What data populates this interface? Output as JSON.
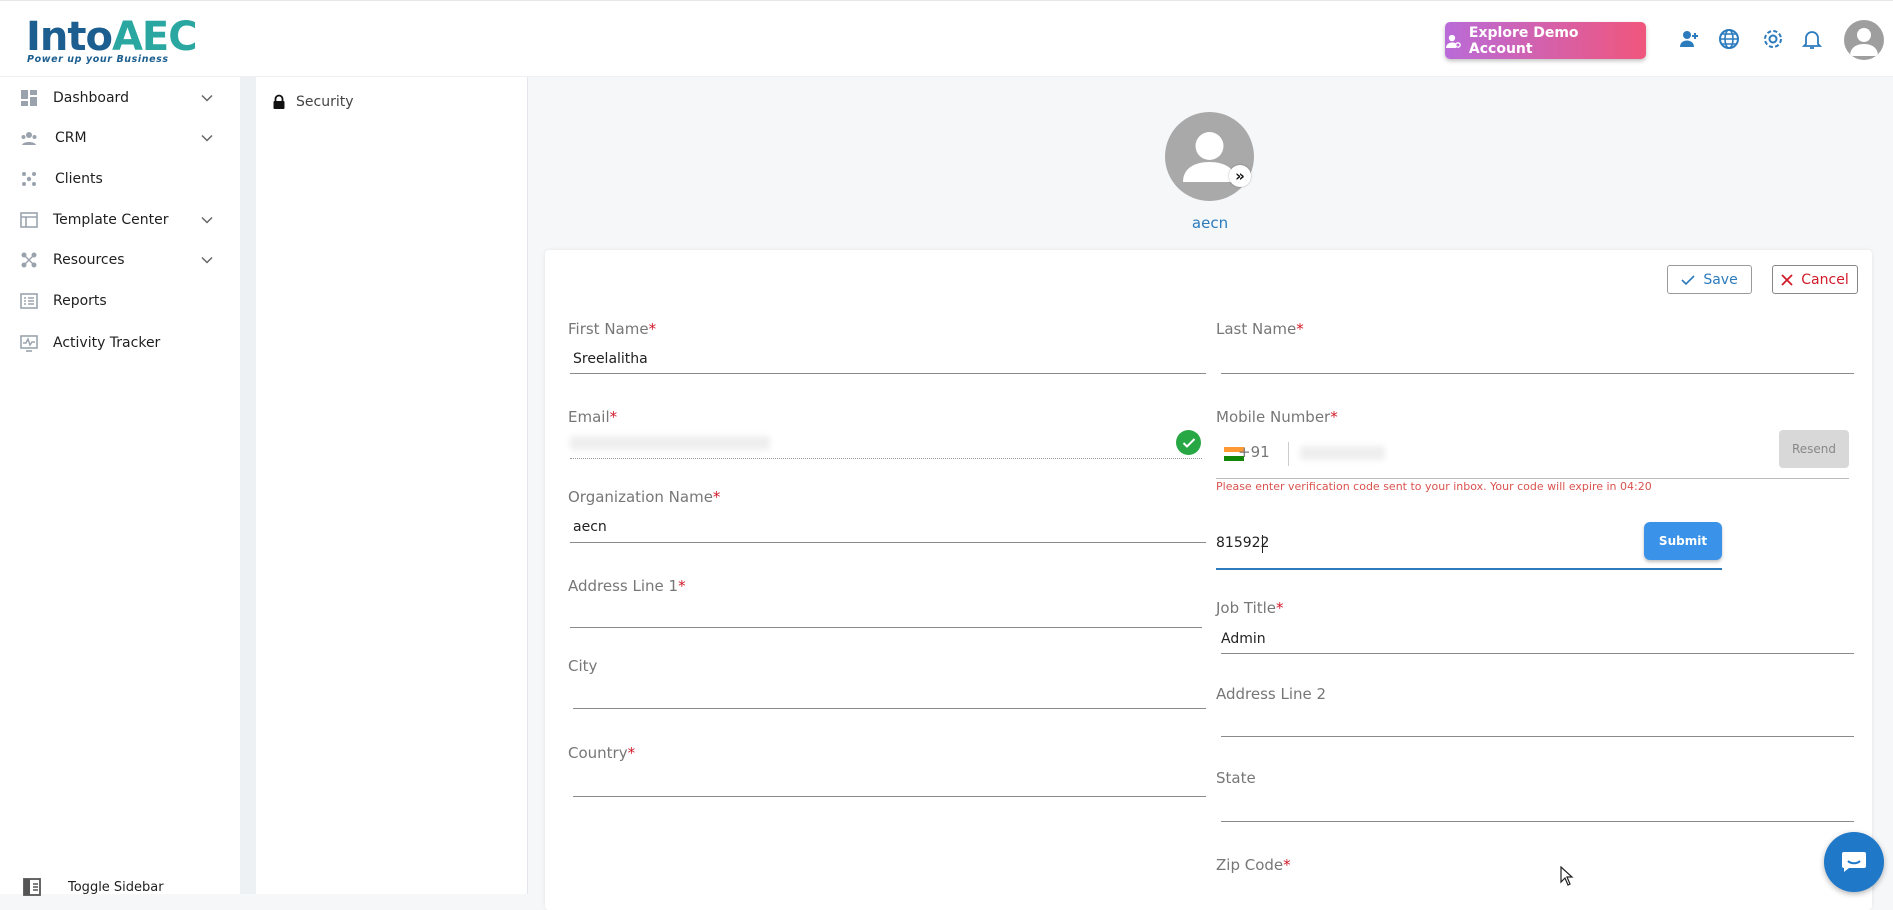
{
  "header": {
    "logo_text_main": "Into",
    "logo_text_accent": "AEC",
    "logo_tagline": "Power up your Business",
    "demo_button_label": "Explore Demo Account",
    "icons": [
      "add-user-icon",
      "globe-icon",
      "gear-icon",
      "bell-icon",
      "avatar-icon"
    ]
  },
  "sidebar": {
    "items": [
      {
        "label": "Dashboard",
        "icon": "dashboard-icon",
        "expandable": true
      },
      {
        "label": "CRM",
        "icon": "crm-icon",
        "expandable": true
      },
      {
        "label": "Clients",
        "icon": "clients-icon",
        "expandable": false
      },
      {
        "label": "Template Center",
        "icon": "template-icon",
        "expandable": true
      },
      {
        "label": "Resources",
        "icon": "resources-icon",
        "expandable": true
      },
      {
        "label": "Reports",
        "icon": "reports-icon",
        "expandable": false
      },
      {
        "label": "Activity Tracker",
        "icon": "activity-icon",
        "expandable": false
      }
    ],
    "toggle_label": "Toggle Sidebar"
  },
  "subnav": {
    "items": [
      {
        "label": "Security",
        "icon": "lock-icon"
      }
    ]
  },
  "profile": {
    "name": "aecn"
  },
  "form": {
    "save_label": "Save",
    "cancel_label": "Cancel",
    "required_mark": "*",
    "first_name": {
      "label": "First Name",
      "value": "Sreelalitha"
    },
    "last_name": {
      "label": "Last Name",
      "value": ""
    },
    "email": {
      "label": "Email",
      "value": ""
    },
    "mobile": {
      "label": "Mobile Number",
      "country_code": "+91",
      "value": "",
      "resend_label": "Resend"
    },
    "otp_message": "Please enter verification code sent to your inbox. Your code will expire in 04:20",
    "otp": {
      "value": "815922",
      "submit_label": "Submit"
    },
    "organization": {
      "label": "Organization Name",
      "value": "aecn"
    },
    "address1": {
      "label": "Address Line 1",
      "value": ""
    },
    "job_title": {
      "label": "Job Title",
      "value": "Admin"
    },
    "city": {
      "label": "City",
      "value": ""
    },
    "address2": {
      "label": "Address Line 2",
      "value": ""
    },
    "country": {
      "label": "Country",
      "value": ""
    },
    "state": {
      "label": "State",
      "value": ""
    },
    "zip": {
      "label": "Zip Code",
      "value": ""
    }
  },
  "colors": {
    "brand_blue": "#1b5e8f",
    "accent_teal": "#2aa7a0",
    "link_blue": "#2c7bbd",
    "required_red": "#d11a2a",
    "success_green": "#28a745"
  }
}
